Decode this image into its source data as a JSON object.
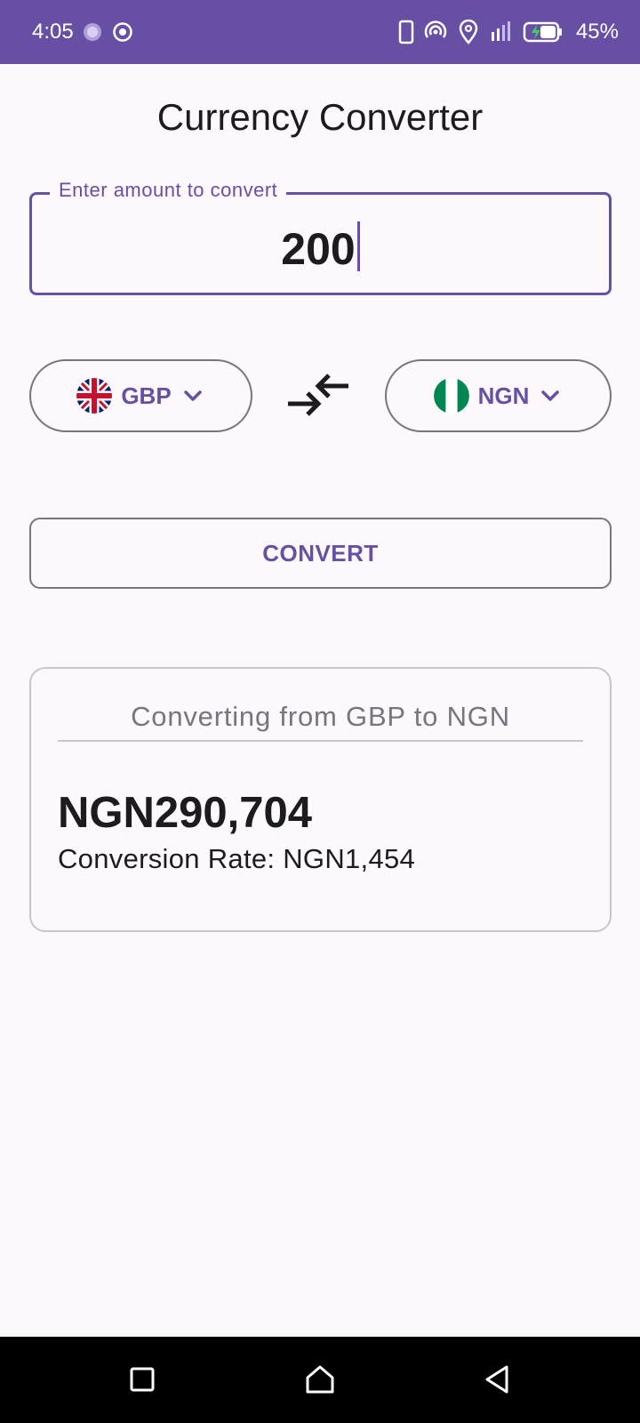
{
  "status_bar": {
    "time": "4:05",
    "battery": "45%",
    "icons": [
      "sync-icon",
      "target-icon",
      "phone-icon",
      "hotspot-icon",
      "location-icon",
      "signal-icon",
      "battery-icon"
    ]
  },
  "title": "Currency Converter",
  "amount_input": {
    "label": "Enter amount to convert",
    "value": "200"
  },
  "from_currency": {
    "code": "GBP",
    "flag": "uk-flag-icon"
  },
  "to_currency": {
    "code": "NGN",
    "flag": "nigeria-flag-icon"
  },
  "convert_button": "CONVERT",
  "result": {
    "heading": "Converting from GBP to NGN",
    "amount": "NGN290,704",
    "rate": "Conversion Rate: NGN1,454"
  },
  "colors": {
    "primary": "#6750a4",
    "background": "#fdf8fc",
    "outline": "#79747e"
  },
  "nav_bar": [
    "recents-icon",
    "home-icon",
    "back-icon"
  ]
}
